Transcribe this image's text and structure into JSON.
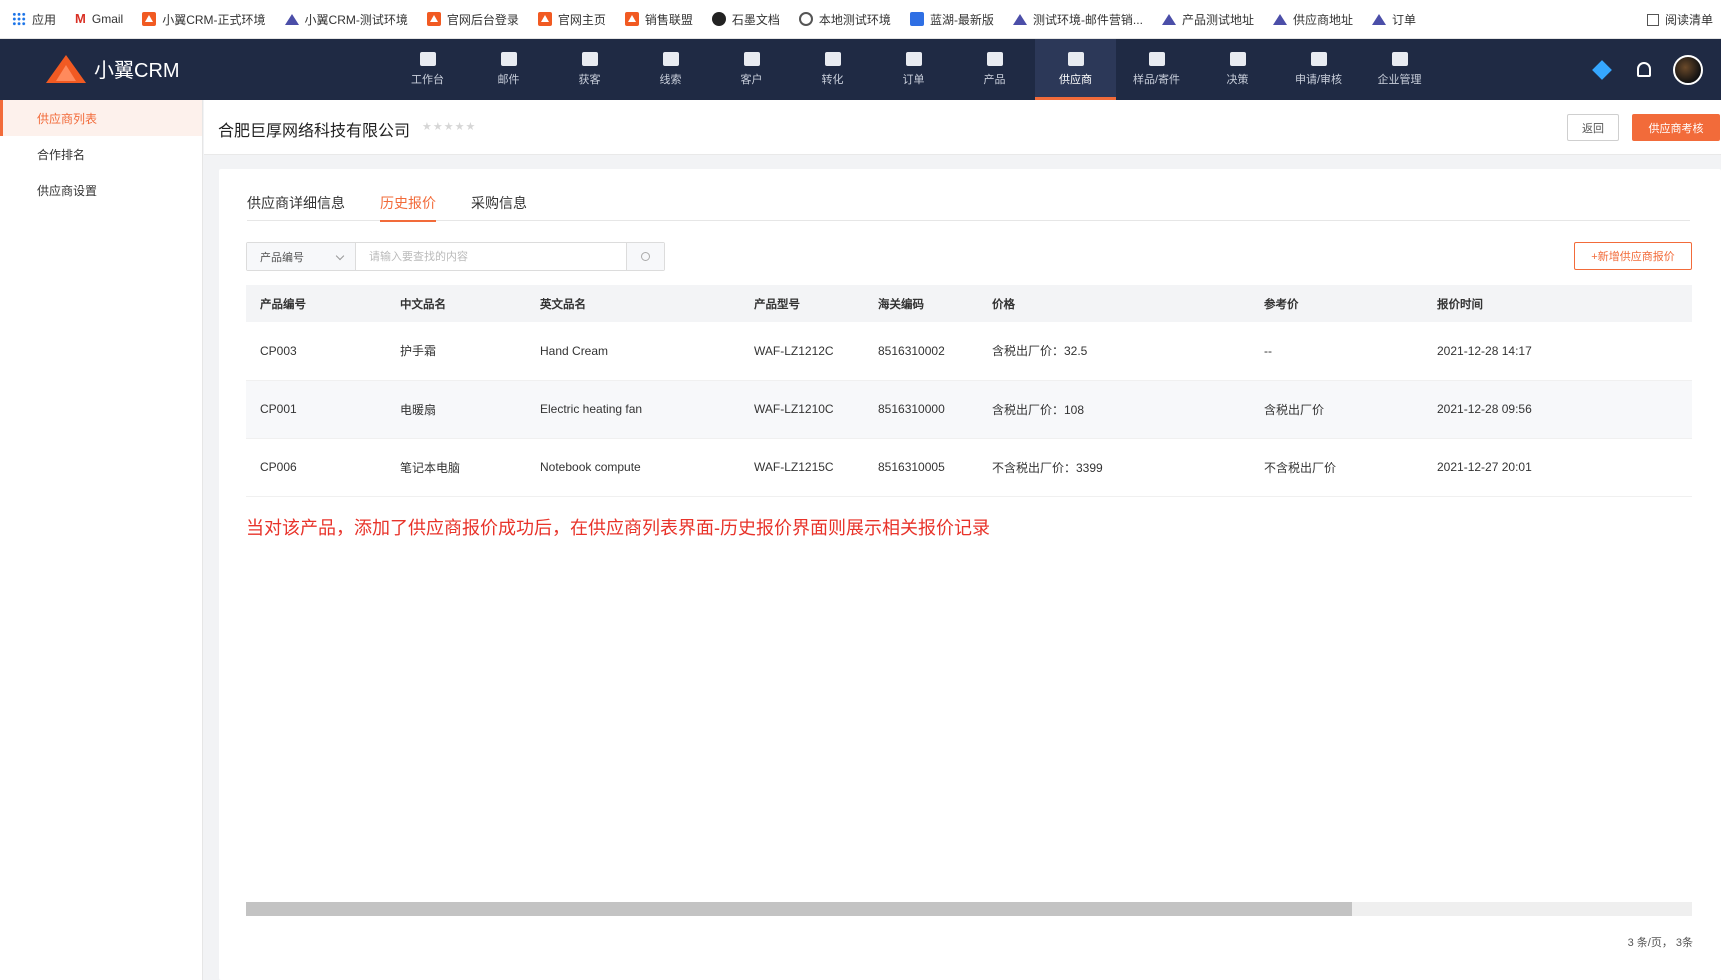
{
  "bookmarks": [
    {
      "icon": "apps-grid-icon",
      "label": "应用"
    },
    {
      "icon": "gmail-icon",
      "label": "Gmail"
    },
    {
      "icon": "xiaoyi-crm-icon",
      "label": "小翼CRM-正式环境"
    },
    {
      "icon": "triangle-icon",
      "label": "小翼CRM-测试环境"
    },
    {
      "icon": "xiaoyi-crm-icon",
      "label": "官网后台登录"
    },
    {
      "icon": "xiaoyi-crm-icon",
      "label": "官网主页"
    },
    {
      "icon": "xiaoyi-crm-icon",
      "label": "销售联盟"
    },
    {
      "icon": "shimo-icon",
      "label": "石墨文档"
    },
    {
      "icon": "globe-icon",
      "label": "本地测试环境"
    },
    {
      "icon": "lanhu-icon",
      "label": "蓝湖-最新版"
    },
    {
      "icon": "triangle-icon",
      "label": "测试环境-邮件营销..."
    },
    {
      "icon": "triangle-icon",
      "label": "产品测试地址"
    },
    {
      "icon": "triangle-icon",
      "label": "供应商地址"
    },
    {
      "icon": "triangle-icon",
      "label": "订单"
    }
  ],
  "reading_list": "阅读清单",
  "brand": {
    "name": "小翼CRM",
    "accent": "#f26b3a",
    "nav_bg": "#1f2a44"
  },
  "nav": [
    {
      "label": "工作台",
      "icon": "workbench-icon"
    },
    {
      "label": "邮件",
      "icon": "mail-icon"
    },
    {
      "label": "获客",
      "icon": "acquire-icon"
    },
    {
      "label": "线索",
      "icon": "leads-icon"
    },
    {
      "label": "客户",
      "icon": "customer-icon"
    },
    {
      "label": "转化",
      "icon": "funnel-icon"
    },
    {
      "label": "订单",
      "icon": "order-icon"
    },
    {
      "label": "产品",
      "icon": "product-icon"
    },
    {
      "label": "供应商",
      "icon": "supplier-icon",
      "active": true
    },
    {
      "label": "样品/寄件",
      "icon": "sample-icon"
    },
    {
      "label": "决策",
      "icon": "chart-icon"
    },
    {
      "label": "申请/审核",
      "icon": "approval-icon"
    },
    {
      "label": "企业管理",
      "icon": "enterprise-icon"
    }
  ],
  "sidebar": [
    {
      "label": "供应商列表",
      "active": true
    },
    {
      "label": "合作排名"
    },
    {
      "label": "供应商设置"
    }
  ],
  "header": {
    "company": "合肥巨厚网络科技有限公司",
    "rating_stars": 5,
    "back_label": "返回",
    "assess_label": "供应商考核"
  },
  "tabs": [
    {
      "label": "供应商详细信息"
    },
    {
      "label": "历史报价",
      "active": true
    },
    {
      "label": "采购信息"
    }
  ],
  "search": {
    "select_value": "产品编号",
    "placeholder": "请输入要查找的内容",
    "value": ""
  },
  "add_button": "+新增供应商报价",
  "table": {
    "headers": [
      "产品编号",
      "中文品名",
      "英文品名",
      "产品型号",
      "海关编码",
      "价格",
      "参考价",
      "报价时间"
    ],
    "rows": [
      [
        "CP003",
        "护手霜",
        "Hand Cream",
        "WAF-LZ1212C",
        "8516310002",
        "含税出厂价：32.5",
        "--",
        "2021-12-28 14:17"
      ],
      [
        "CP001",
        "电暖扇",
        "Electric heating fan",
        "WAF-LZ1210C",
        "8516310000",
        "含税出厂价：108",
        "含税出厂价",
        "2021-12-28 09:56"
      ],
      [
        "CP006",
        "笔记本电脑",
        "Notebook compute",
        "WAF-LZ1215C",
        "8516310005",
        "不含税出厂价：3399",
        "不含税出厂价",
        "2021-12-27 20:01"
      ]
    ]
  },
  "note": "当对该产品，添加了供应商报价成功后，在供应商列表界面-历史报价界面则展示相关报价记录",
  "pagination": "3 条/页，  3条"
}
